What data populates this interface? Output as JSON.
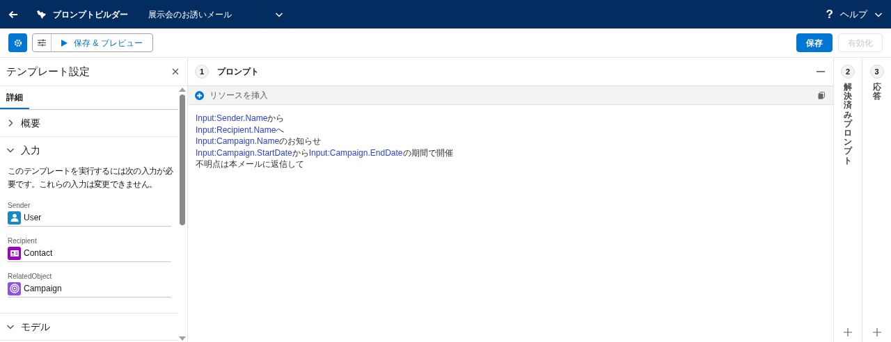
{
  "top_bar": {
    "app_name": "プロンプトビルダー",
    "tabs": [
      {
        "label": "展示会のお誘いメール",
        "selected": true
      }
    ],
    "help_icon": "?",
    "help": "ヘルプ"
  },
  "toolbar": {
    "preview_button": "保存 & プレビュー",
    "buttons": [
      {
        "label": "保存",
        "kind": "primary",
        "disabled": false
      },
      {
        "label": "有効化",
        "kind": "neutral",
        "disabled": true
      }
    ]
  },
  "settings_panel": {
    "title": "テンプレート設定",
    "tabs": [
      {
        "label": "詳細",
        "selected": true
      }
    ],
    "sections": [
      {
        "title": "概要",
        "expanded": false
      },
      {
        "title": "入力",
        "expanded": true,
        "description": "このテンプレートを実行するには次の入力が必要です。これらの入力は変更できません。",
        "inputs": [
          {
            "label": "Sender",
            "value": "User",
            "kind": "user"
          },
          {
            "label": "Recipient",
            "value": "Contact",
            "kind": "contact"
          },
          {
            "label": "RelatedObject",
            "value": "Campaign",
            "kind": "campaign"
          }
        ]
      },
      {
        "title": "モデル",
        "expanded": true
      }
    ]
  },
  "prompt_panel": {
    "step": "1",
    "title": "プロンプト",
    "insert_resource": "リソースを挿入",
    "lines": [
      [
        {
          "kind": "merge",
          "text": "Input:Sender.Name"
        },
        {
          "kind": "text",
          "text": "から"
        }
      ],
      [
        {
          "kind": "merge",
          "text": "Input:Recipient.Name"
        },
        {
          "kind": "text",
          "text": "へ"
        }
      ],
      [
        {
          "kind": "merge",
          "text": "Input:Campaign.Name"
        },
        {
          "kind": "text",
          "text": "のお知らせ"
        }
      ],
      [
        {
          "kind": "merge",
          "text": "Input:Campaign.StartDate"
        },
        {
          "kind": "text",
          "text": "から"
        },
        {
          "kind": "merge",
          "text": "Input:Campaign.EndDate"
        },
        {
          "kind": "text",
          "text": "の期間で開催"
        }
      ],
      [
        {
          "kind": "text",
          "text": "不明点は本メールに返信して"
        }
      ]
    ]
  },
  "side_panels": [
    {
      "step": "2",
      "title": "解決済みプロンプト"
    },
    {
      "step": "3",
      "title": "応答"
    }
  ]
}
